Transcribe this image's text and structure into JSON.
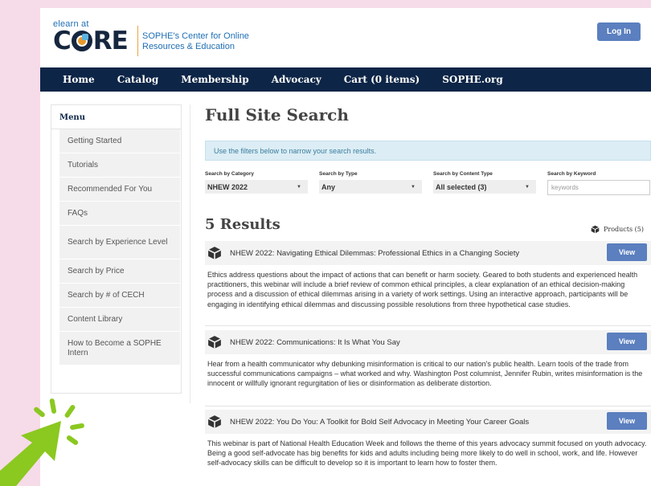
{
  "header": {
    "logo_small": "elearn at",
    "logo_big_prefix": "C",
    "logo_big_suffix": "RE",
    "tagline_line1": "SOPHE's Center for Online",
    "tagline_line2": "Resources & Education",
    "login_label": "Log In"
  },
  "nav": [
    "Home",
    "Catalog",
    "Membership",
    "Advocacy",
    "Cart (0 items)",
    "SOPHE.org"
  ],
  "sidebar": {
    "title": "Menu",
    "items": [
      "Getting Started",
      "Tutorials",
      "Recommended For You",
      "FAQs",
      "Search by Experience Level",
      "Search by Price",
      "Search by # of CECH",
      "Content Library",
      "How to Become a SOPHE Intern"
    ]
  },
  "main": {
    "title": "Full Site Search",
    "info": "Use the filters below to narrow your search results.",
    "filters": {
      "category_label": "Search by Category",
      "category_value": "NHEW 2022",
      "type_label": "Search by Type",
      "type_value": "Any",
      "content_type_label": "Search by Content Type",
      "content_type_value": "All selected (3)",
      "keyword_label": "Search by Keyword",
      "keyword_placeholder": "keywords"
    },
    "results_title": "5 Results",
    "products_label": "Products (5)",
    "view_label": "View",
    "results": [
      {
        "title": "NHEW 2022: Navigating Ethical Dilemmas: Professional Ethics in a Changing Society",
        "desc": "Ethics address questions about the impact of actions that can benefit or harm society. Geared to both students and experienced health practitioners, this webinar will include a brief review of common ethical principles, a clear explanation of an ethical decision-making process and a discussion of ethical dilemmas arising in a variety of work settings. Using an interactive approach, participants will be engaging in identifying ethical dilemmas and discussing possible resolutions from three hypothetical case studies."
      },
      {
        "title": "NHEW 2022: Communications: It Is What You Say",
        "desc": "Hear from a health communicator why debunking misinformation is critical to our nation's public health. Learn tools of the trade from successful communications campaigns – what worked and why. Washington Post columnist, Jennifer Rubin, writes misinformation is the innocent or willfully ignorant regurgitation of lies or disinformation as deliberate distortion."
      },
      {
        "title": "NHEW 2022: You Do You: A Toolkit for Bold Self Advocacy in Meeting Your Career Goals",
        "desc": "This webinar is part of National Health Education Week and follows the theme of this years advocacy summit focused on youth advocacy. Being a good self-advocate has big benefits for kids and adults including being more likely to do well in school, work, and life. However self-advocacy skills can be difficult to develop so it is important to learn how to foster them."
      }
    ]
  },
  "colors": {
    "background": "#f6dbe8",
    "nav_bg": "#0d2547",
    "button": "#5b7fbf",
    "info_bg": "#dcedf5",
    "cursor": "#8bc820"
  },
  "icons": {
    "result_icon": "box-icon",
    "products_icon": "box-icon",
    "cursor": "pointer-arrow-icon"
  }
}
